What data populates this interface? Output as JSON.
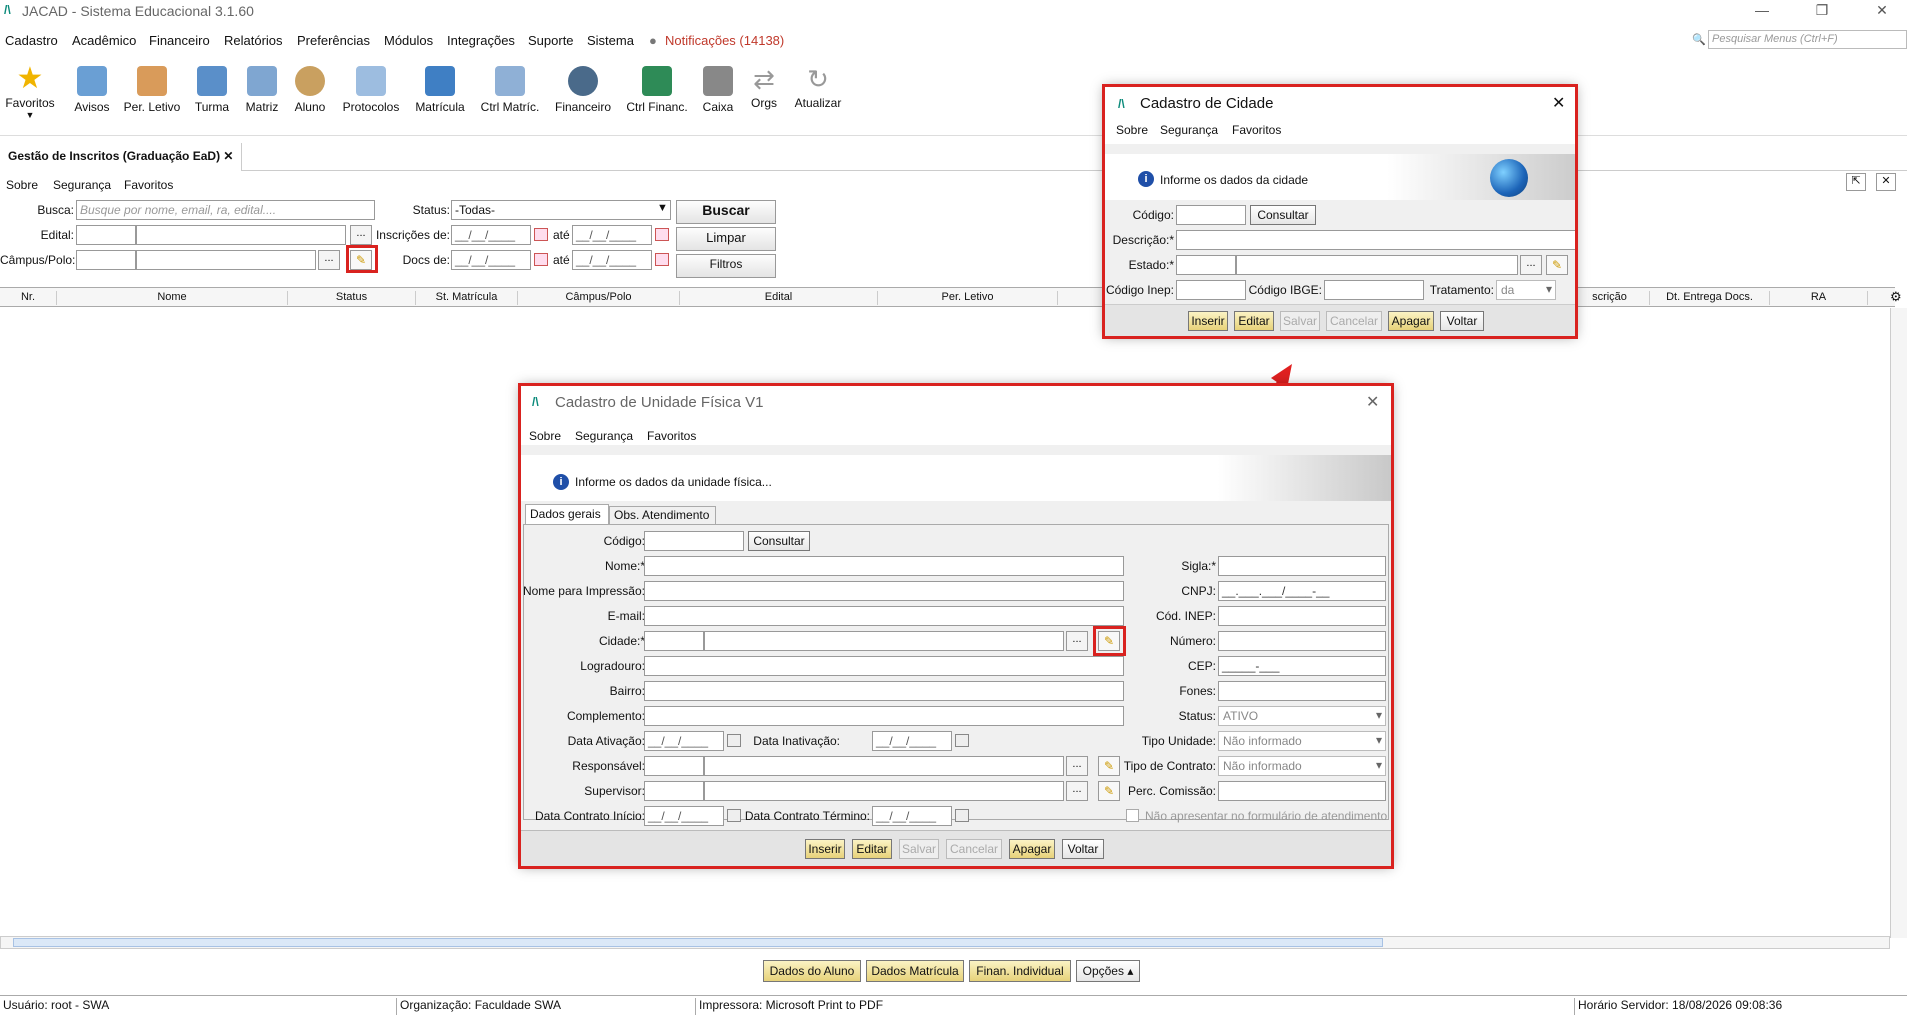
{
  "window": {
    "title": "JACAD - Sistema Educacional 3.1.60",
    "logo": "/\\"
  },
  "menu": {
    "items": [
      "Cadastro",
      "Acadêmico",
      "Financeiro",
      "Relatórios",
      "Preferências",
      "Módulos",
      "Integrações",
      "Suporte",
      "Sistema"
    ],
    "notifications": "Notificações (14138)",
    "search_placeholder": "Pesquisar Menus (Ctrl+F)"
  },
  "toolbar": {
    "items": [
      "Favoritos",
      "Avisos",
      "Per. Letivo",
      "Turma",
      "Matriz",
      "Aluno",
      "Protocolos",
      "Matrícula",
      "Ctrl Matríc.",
      "Financeiro",
      "Ctrl Financ.",
      "Caixa",
      "Orgs",
      "Atualizar"
    ]
  },
  "tab": {
    "label": "Gestão de Inscritos (Graduação EaD)",
    "close": "✕"
  },
  "submenu": [
    "Sobre",
    "Segurança",
    "Favoritos"
  ],
  "filters": {
    "busca_label": "Busca:",
    "busca_placeholder": "Busque por nome, email, ra, edital....",
    "edital_label": "Edital:",
    "campus_label": "Câmpus/Polo:",
    "status_label": "Status:",
    "status_value": "-Todas-",
    "inscricoes_label": "Inscrições de:",
    "docs_label": "Docs de:",
    "ate": "até",
    "date_mask": "__/__/____",
    "dots": "...",
    "buscar": "Buscar",
    "limpar": "Limpar",
    "filtros": "Filtros"
  },
  "grid": {
    "columns": [
      "Nr.",
      "Nome",
      "Status",
      "St. Matrícula",
      "Câmpus/Polo",
      "Edital",
      "Per. Letivo",
      "scrição",
      "Dt. Entrega Docs.",
      "RA"
    ]
  },
  "cidade_dialog": {
    "title": "Cadastro de Cidade",
    "menu": [
      "Sobre",
      "Segurança",
      "Favoritos"
    ],
    "info": "Informe os dados da cidade",
    "codigo": "Código:",
    "consultar": "Consultar",
    "descricao": "Descrição:*",
    "estado": "Estado:*",
    "codigo_inep": "Código Inep:",
    "codigo_ibge": "Código IBGE:",
    "tratamento": "Tratamento:",
    "tratamento_value": "da",
    "buttons": [
      "Inserir",
      "Editar",
      "Salvar",
      "Cancelar",
      "Apagar",
      "Voltar"
    ]
  },
  "unidade_dialog": {
    "title": "Cadastro de Unidade Física V1",
    "menu": [
      "Sobre",
      "Segurança",
      "Favoritos"
    ],
    "info": "Informe os dados da unidade física...",
    "tabs": [
      "Dados gerais",
      "Obs. Atendimento"
    ],
    "left_labels": [
      "Código:",
      "Nome:*",
      "Nome para Impressão:",
      "E-mail:",
      "Cidade:*",
      "Logradouro:",
      "Bairro:",
      "Complemento:",
      "Data Ativação:",
      "Responsável:",
      "Supervisor:",
      "Data Contrato Início:"
    ],
    "data_inativacao": "Data Inativação:",
    "data_contrato_termino": "Data Contrato Término:",
    "consultar": "Consultar",
    "right_labels": [
      "Sigla:*",
      "CNPJ:",
      "Cód. INEP:",
      "Número:",
      "CEP:",
      "Fones:",
      "Status:",
      "Tipo Unidade:",
      "Tipo de Contrato:",
      "Perc. Comissão:"
    ],
    "cnpj_mask": "__.___.___/____-__",
    "cep_mask": "_____-___",
    "status_value": "ATIVO",
    "tipo_unidade_value": "Não informado",
    "tipo_contrato_value": "Não informado",
    "checkbox_label": "Não apresentar no formulário de atendimento",
    "date_mask": "__/__/____",
    "buttons": [
      "Inserir",
      "Editar",
      "Salvar",
      "Cancelar",
      "Apagar",
      "Voltar"
    ]
  },
  "bottom_buttons": [
    "Dados do Aluno",
    "Dados Matrícula",
    "Finan. Individual",
    "Opções"
  ],
  "status": {
    "user": "Usuário: root - SWA",
    "org": "Organização: Faculdade SWA",
    "printer": "Impressora: Microsoft Print to PDF",
    "server": "Horário Servidor: 18/08/2026 09:08:36"
  }
}
